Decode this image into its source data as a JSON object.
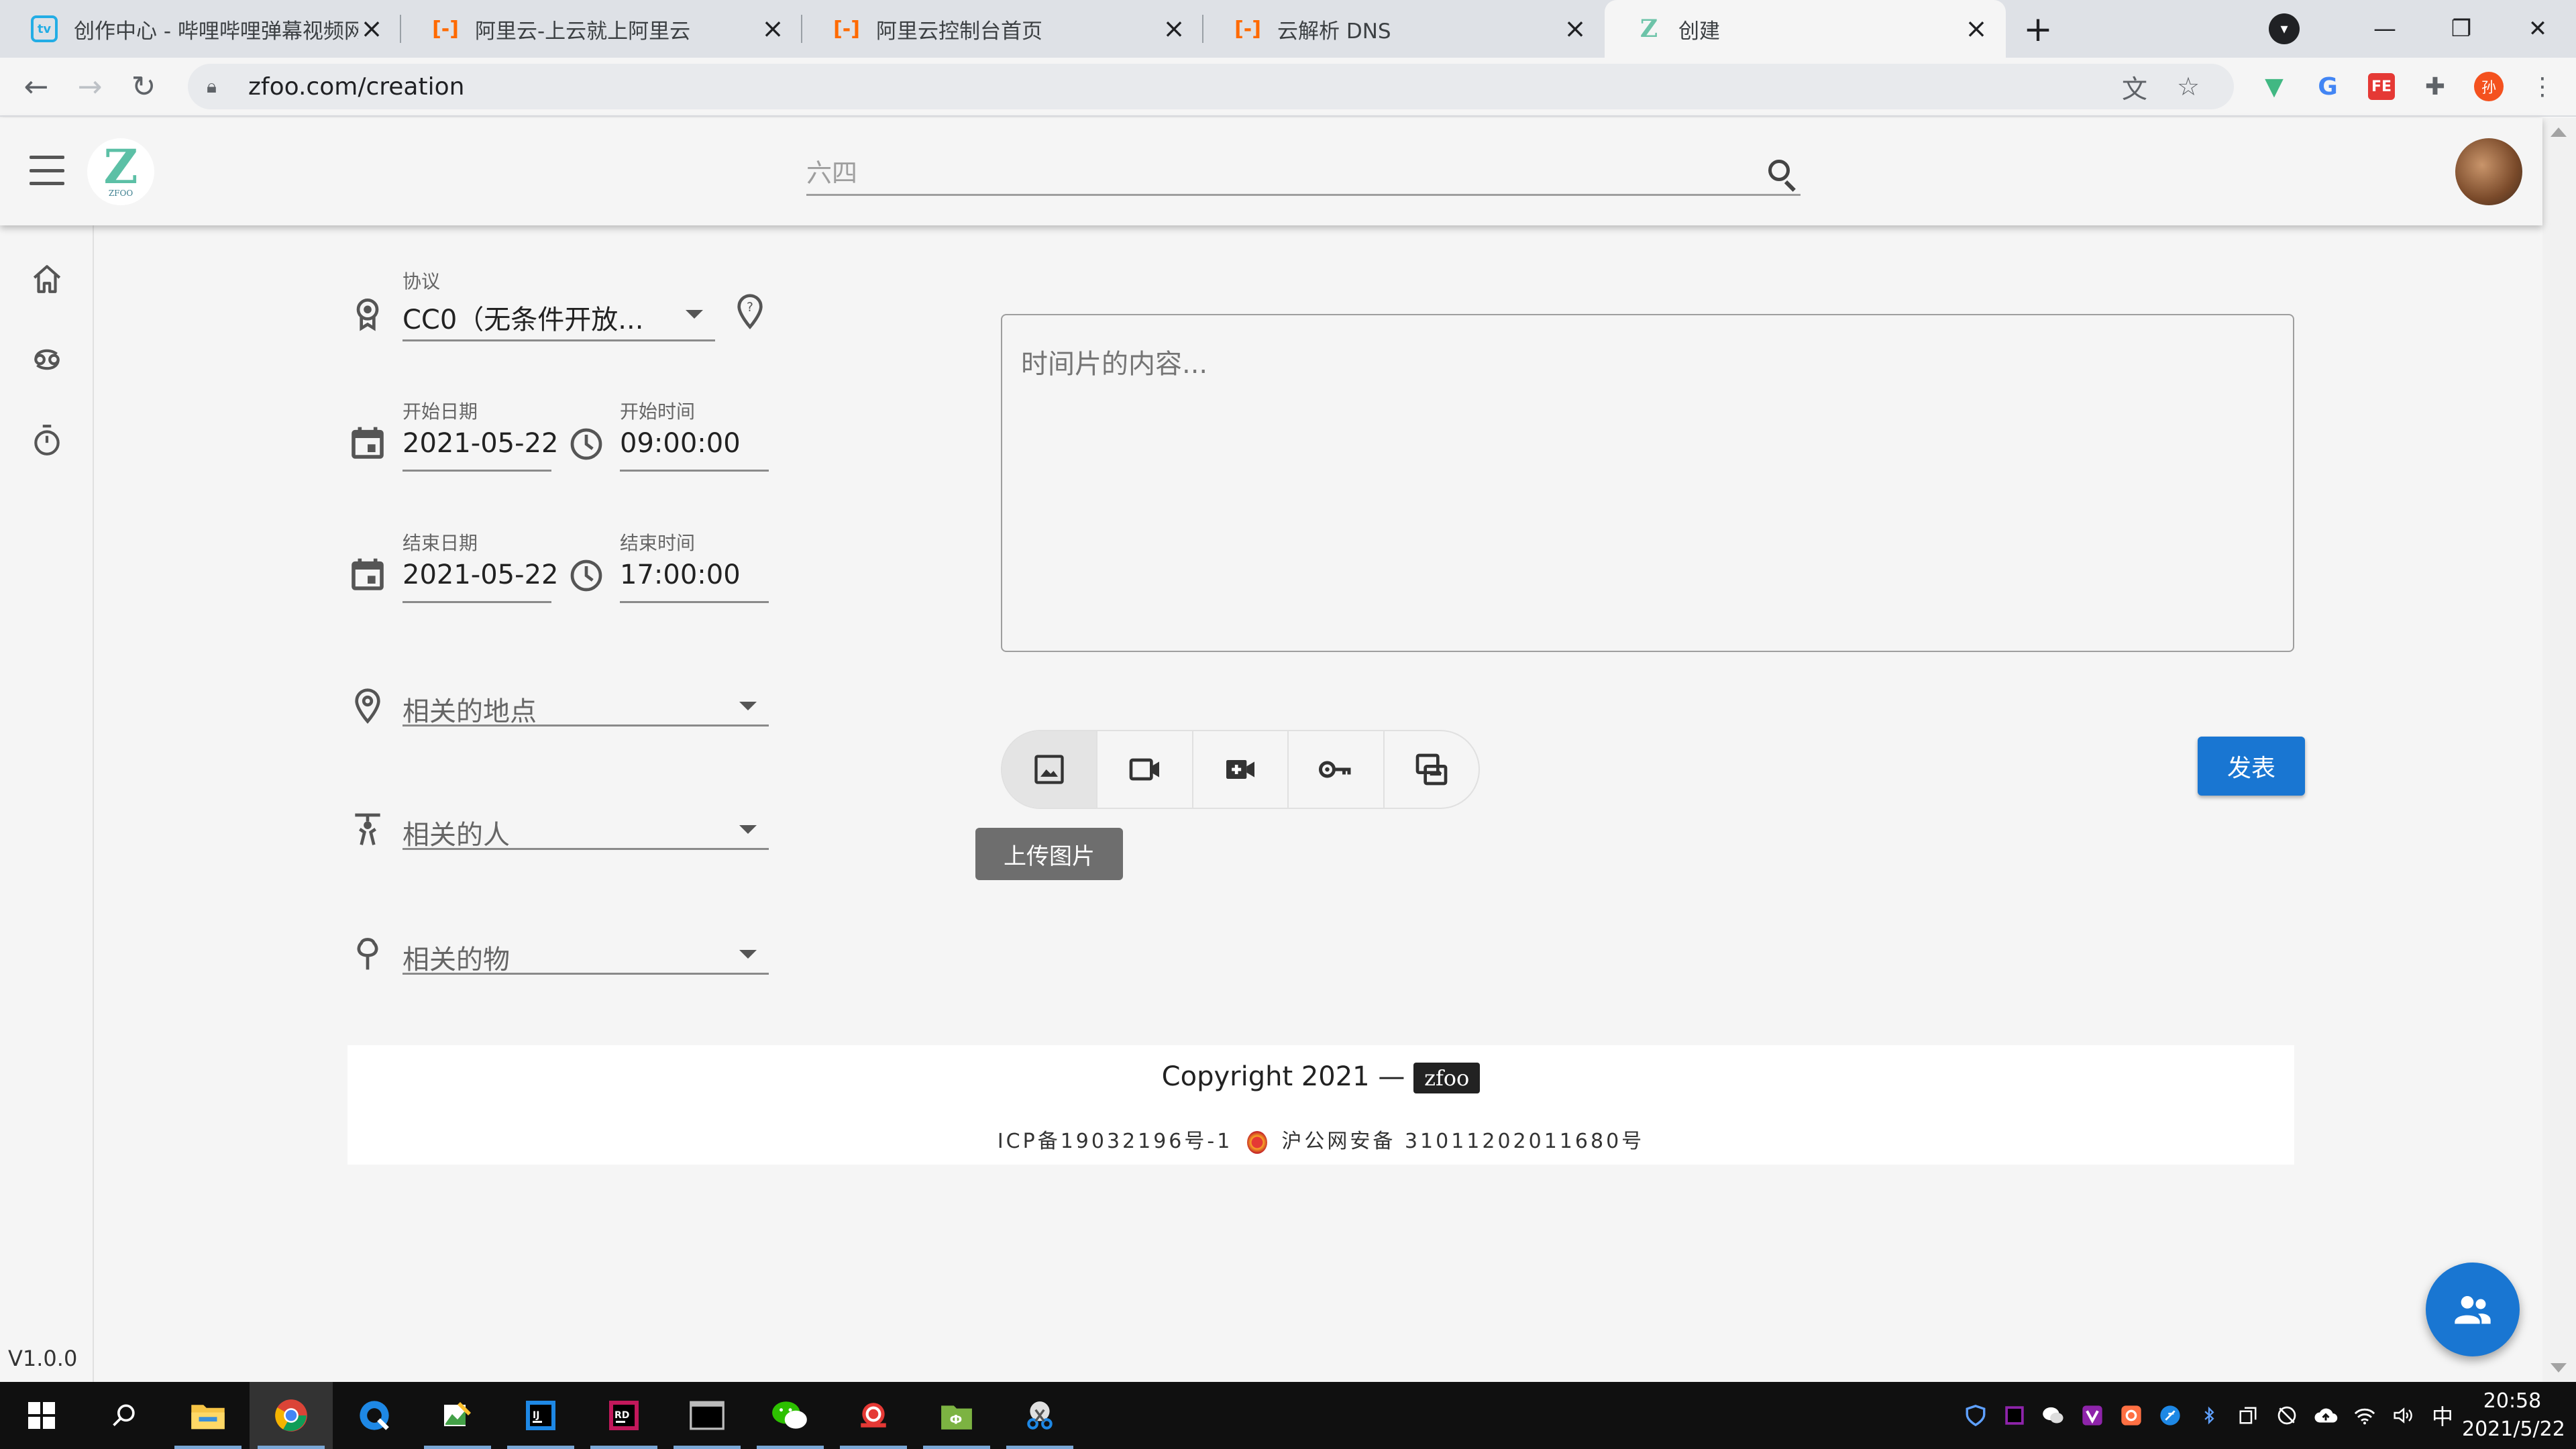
{
  "browser": {
    "tabs": [
      {
        "title": "创作中心 - 哔哩哔哩弹幕视频网",
        "favicon": "bilibili-icon",
        "active": false
      },
      {
        "title": "阿里云-上云就上阿里云",
        "favicon": "aliyun-icon",
        "active": false
      },
      {
        "title": "阿里云控制台首页",
        "favicon": "aliyun-icon",
        "active": false
      },
      {
        "title": "云解析 DNS",
        "favicon": "aliyun-icon",
        "active": false
      },
      {
        "title": "创建",
        "favicon": "zfoo-icon",
        "active": true
      }
    ],
    "url": "zfoo.com/creation",
    "extension_avatar_text": "孙"
  },
  "appbar": {
    "search_placeholder": "六四"
  },
  "form": {
    "license": {
      "label": "协议",
      "value": "CC0（无条件开放..."
    },
    "start_date": {
      "label": "开始日期",
      "value": "2021-05-22"
    },
    "start_time": {
      "label": "开始时间",
      "value": "09:00:00"
    },
    "end_date": {
      "label": "结束日期",
      "value": "2021-05-22"
    },
    "end_time": {
      "label": "结束时间",
      "value": "17:00:00"
    },
    "place": {
      "placeholder": "相关的地点"
    },
    "person": {
      "placeholder": "相关的人"
    },
    "thing": {
      "placeholder": "相关的物"
    }
  },
  "editor": {
    "content_placeholder": "时间片的内容...",
    "media_buttons": [
      "image-icon",
      "video-icon",
      "video-add-icon",
      "key-icon",
      "swap-icon"
    ],
    "tooltip": "上传图片",
    "publish_label": "发表"
  },
  "footer": {
    "copyright": "Copyright 2021 —",
    "brand": "zfoo",
    "icp": "ICP备19032196号-1",
    "police": "沪公网安备 31011202011680号"
  },
  "version": "V1.0.0",
  "taskbar": {
    "time": "20:58",
    "date": "2021/5/22",
    "ime": "中"
  },
  "colors": {
    "primary": "#1976d2",
    "background": "#f5f5f5"
  }
}
